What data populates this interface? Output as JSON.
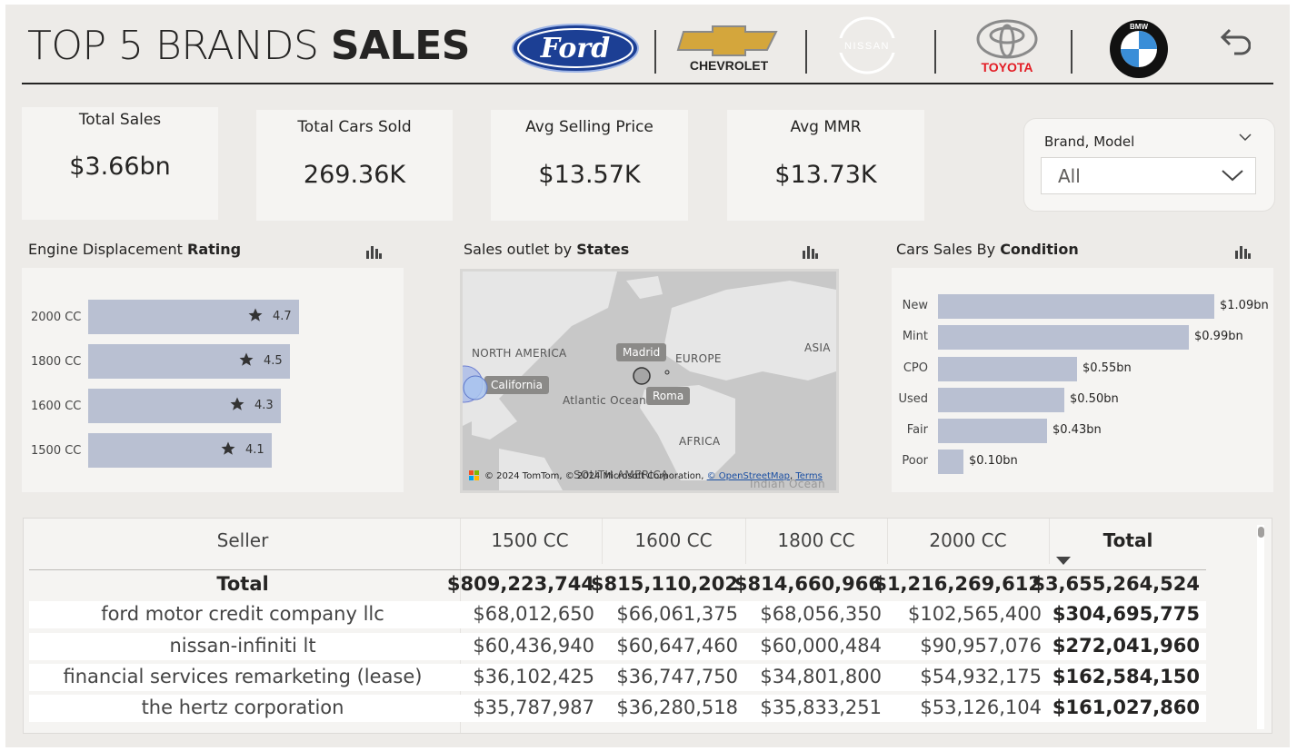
{
  "header": {
    "title_light": "TOP 5 BRANDS ",
    "title_bold": "SALES",
    "brands": [
      "Ford",
      "CHEVROLET",
      "NISSAN",
      "TOYOTA",
      "BMW"
    ],
    "colors": {
      "ford_blue": "#1c3f94",
      "chevy_gold": "#d4a63c",
      "toyota_red": "#e31b23",
      "bmw_blue": "#3a8ed8"
    }
  },
  "kpis": [
    {
      "label": "Total Sales",
      "value": "$3.66bn"
    },
    {
      "label": "Total Cars Sold",
      "value": "269.36K"
    },
    {
      "label": "Avg Selling Price",
      "value": "$13.57K"
    },
    {
      "label": "Avg MMR",
      "value": "$13.73K"
    }
  ],
  "slicer": {
    "label": "Brand, Model",
    "value": "All"
  },
  "rating_panel": {
    "title_light": "Engine Displacement ",
    "title_bold": "Rating",
    "rows": [
      {
        "category": "2000 CC",
        "rating": "4.7"
      },
      {
        "category": "1800 CC",
        "rating": "4.5"
      },
      {
        "category": "1600 CC",
        "rating": "4.3"
      },
      {
        "category": "1500 CC",
        "rating": "4.1"
      }
    ]
  },
  "map_panel": {
    "title_light": "Sales outlet by ",
    "title_bold": "States",
    "labels": {
      "north_america": "NORTH AMERICA",
      "europe": "EUROPE",
      "asia": "ASIA",
      "atlantic": "Atlantic Ocean",
      "africa": "AFRICA",
      "south_america": "SOUTH AMERICA",
      "indian": "Indian Ocean",
      "madrid": "Madrid",
      "california": "California",
      "roma": "Roma"
    },
    "attribution_prefix": "© 2024 TomTom, © 2024 Microsoft Corporation, ",
    "attribution_osm": "© OpenStreetMap",
    "attribution_terms": "Terms"
  },
  "condition_panel": {
    "title_light": "Cars Sales By ",
    "title_bold": "Condition"
  },
  "chart_data": [
    {
      "type": "bar",
      "orientation": "horizontal",
      "categories": [
        "2000 CC",
        "1800 CC",
        "1600 CC",
        "1500 CC"
      ],
      "values": [
        4.7,
        4.5,
        4.3,
        4.1
      ]
    },
    {
      "type": "bar",
      "orientation": "horizontal",
      "categories": [
        "New",
        "Mint",
        "CPO",
        "Used",
        "Fair",
        "Poor"
      ],
      "values": [
        1.09,
        0.99,
        0.55,
        0.5,
        0.43,
        0.1
      ],
      "labels": [
        "$1.09bn",
        "$0.99bn",
        "$0.55bn",
        "$0.50bn",
        "$0.43bn",
        "$0.10bn"
      ]
    }
  ],
  "table": {
    "columns": [
      "Seller",
      "1500 CC",
      "1600 CC",
      "1800 CC",
      "2000 CC",
      "Total"
    ],
    "total_row": {
      "label": "Total",
      "values": [
        "$809,223,744",
        "$815,110,202",
        "$814,660,966",
        "$1,216,269,612",
        "$3,655,264,524"
      ]
    },
    "rows": [
      {
        "seller": "ford motor credit company llc",
        "values": [
          "$68,012,650",
          "$66,061,375",
          "$68,056,350",
          "$102,565,400",
          "$304,695,775"
        ]
      },
      {
        "seller": "nissan-infiniti lt",
        "values": [
          "$60,436,940",
          "$60,647,460",
          "$60,000,484",
          "$90,957,076",
          "$272,041,960"
        ]
      },
      {
        "seller": "financial services remarketing (lease)",
        "values": [
          "$36,102,425",
          "$36,747,750",
          "$34,801,800",
          "$54,932,175",
          "$162,584,150"
        ]
      },
      {
        "seller": "the hertz corporation",
        "values": [
          "$35,787,987",
          "$36,280,518",
          "$35,833,251",
          "$53,126,104",
          "$161,027,860"
        ]
      }
    ]
  }
}
